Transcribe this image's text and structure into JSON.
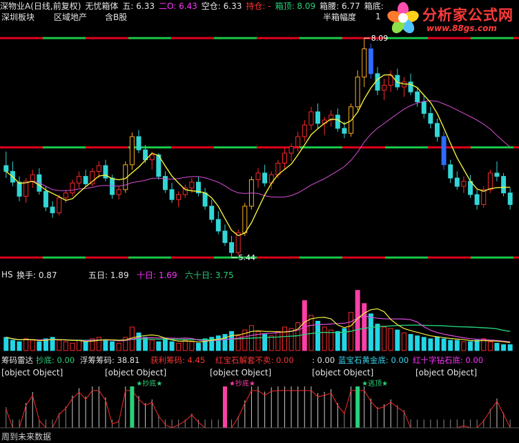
{
  "header": {
    "stock_title": "深物业A(日线,前复权)",
    "indicator_name": "无忧箱体",
    "items": [
      {
        "label": "五: 6.33",
        "color": "#e6e6e6"
      },
      {
        "label": "二O: 6.43",
        "color": "#ff33ff"
      },
      {
        "label": "空仓: 6.33",
        "color": "#e6e6e6"
      },
      {
        "label": "持仓: -",
        "color": "#ff3333"
      },
      {
        "label": "箱顶: 8.09",
        "color": "#27d27a"
      },
      {
        "label": "箱腰: 6.77",
        "color": "#e6e6e6"
      },
      {
        "label": "箱底:",
        "color": "#e6e6e6"
      }
    ],
    "row2": [
      "深圳板块",
      "区域地产",
      "含B股",
      "半箱幅度",
      "1"
    ]
  },
  "logo": {
    "brand": "分析家公式网",
    "site": "www.88gs.com"
  },
  "volume_header": {
    "prefix": "HS",
    "items": [
      {
        "label": "换手: 0.87",
        "color": "#e6e6e6"
      },
      {
        "label": "五日: 1.89",
        "color": "#e6e6e6"
      },
      {
        "label": "十日: 1.69",
        "color": "#ff33ff"
      },
      {
        "label": "六十日: 3.75",
        "color": "#27d27a"
      }
    ]
  },
  "lower_header": {
    "row1": [
      {
        "label": "筹码雷达",
        "color": "#e6e6e6"
      },
      {
        "label": "抄底: 0.00",
        "color": "#27d27a"
      },
      {
        "label": "浮筹筹码: 38.81",
        "color": "#e6e6e6"
      },
      {
        "label": "获利筹码: 4.45",
        "color": "#ff3333"
      },
      {
        "label": "红宝石解套不卖: 0.00",
        "color": "#ff3333"
      },
      {
        "label": ": 0.00",
        "color": "#e6e6e6"
      },
      {
        "label": "蓝宝石黄金底: 0.00",
        "color": "#38d8f0"
      },
      {
        "label": "红十字钻石底: 0.00",
        "color": "#ff33ff"
      }
    ],
    "row2": [
      {
        "label": "黑马起爆吃橘子",
        "color": "#e6e6e6"
      },
      {
        "label": "白色凸起能量大",
        "color": "#e6e6e6"
      },
      {
        "label": "空红柱穿透10",
        "color": "#e6e6e6"
      },
      {
        "label": "红实柱穿透20",
        "color": "#e6e6e6"
      },
      {
        "label": "获利99就走人",
        "color": "#e6e6e6"
      }
    ],
    "markers": [
      "抄底",
      "抄底",
      "逃顶"
    ]
  },
  "footer": {
    "label": "周到未来数据"
  },
  "chart_data": {
    "type": "candlestick",
    "box_levels": {
      "top": 8.09,
      "waist": 6.77,
      "bottom": 5.44
    },
    "annotations": [
      {
        "label": "8.09",
        "value": 8.09
      },
      {
        "label": "5.44",
        "value": 5.44
      }
    ],
    "price_range": [
      5.4,
      8.2
    ],
    "ohlc": [
      [
        6.55,
        6.72,
        6.4,
        6.48
      ],
      [
        6.48,
        6.6,
        6.3,
        6.35
      ],
      [
        6.35,
        6.42,
        6.12,
        6.18
      ],
      [
        6.18,
        6.4,
        6.1,
        6.36
      ],
      [
        6.36,
        6.5,
        6.28,
        6.44
      ],
      [
        6.44,
        6.52,
        6.2,
        6.24
      ],
      [
        6.24,
        6.3,
        6.0,
        6.05
      ],
      [
        6.05,
        6.12,
        5.92,
        5.98
      ],
      [
        5.98,
        6.2,
        5.95,
        6.16
      ],
      [
        6.16,
        6.26,
        6.1,
        6.22
      ],
      [
        6.22,
        6.38,
        6.18,
        6.34
      ],
      [
        6.34,
        6.48,
        6.28,
        6.42
      ],
      [
        6.42,
        6.5,
        6.3,
        6.33
      ],
      [
        6.33,
        6.52,
        6.3,
        6.48
      ],
      [
        6.48,
        6.6,
        6.4,
        6.55
      ],
      [
        6.55,
        6.62,
        6.36,
        6.4
      ],
      [
        6.4,
        6.44,
        6.15,
        6.2
      ],
      [
        6.2,
        6.3,
        6.14,
        6.26
      ],
      [
        6.26,
        6.6,
        6.22,
        6.56
      ],
      [
        6.56,
        6.95,
        6.5,
        6.9
      ],
      [
        6.9,
        6.98,
        6.7,
        6.74
      ],
      [
        6.74,
        6.8,
        6.58,
        6.62
      ],
      [
        6.62,
        6.72,
        6.5,
        6.68
      ],
      [
        6.68,
        6.7,
        6.38,
        6.42
      ],
      [
        6.42,
        6.48,
        6.22,
        6.26
      ],
      [
        6.26,
        6.34,
        6.1,
        6.14
      ],
      [
        6.14,
        6.24,
        6.05,
        6.2
      ],
      [
        6.2,
        6.32,
        6.16,
        6.28
      ],
      [
        6.28,
        6.4,
        6.22,
        6.35
      ],
      [
        6.35,
        6.42,
        6.18,
        6.22
      ],
      [
        6.22,
        6.28,
        6.02,
        6.06
      ],
      [
        6.06,
        6.14,
        5.86,
        5.9
      ],
      [
        5.9,
        6.0,
        5.72,
        5.76
      ],
      [
        5.76,
        5.84,
        5.58,
        5.62
      ],
      [
        5.62,
        5.7,
        5.44,
        5.5
      ],
      [
        5.5,
        5.78,
        5.46,
        5.74
      ],
      [
        5.74,
        6.1,
        5.7,
        6.06
      ],
      [
        6.06,
        6.42,
        6.02,
        6.38
      ],
      [
        6.38,
        6.52,
        6.28,
        6.46
      ],
      [
        6.46,
        6.56,
        6.3,
        6.34
      ],
      [
        6.34,
        6.48,
        6.26,
        6.44
      ],
      [
        6.44,
        6.62,
        6.4,
        6.58
      ],
      [
        6.58,
        6.76,
        6.5,
        6.7
      ],
      [
        6.7,
        6.82,
        6.6,
        6.78
      ],
      [
        6.78,
        6.96,
        6.72,
        6.9
      ],
      [
        6.9,
        7.1,
        6.84,
        7.04
      ],
      [
        7.04,
        7.26,
        6.98,
        7.2
      ],
      [
        7.2,
        7.3,
        7.0,
        7.06
      ],
      [
        7.06,
        7.14,
        6.92,
        7.1
      ],
      [
        7.1,
        7.22,
        7.02,
        7.16
      ],
      [
        7.16,
        7.24,
        6.96,
        7.0
      ],
      [
        7.0,
        7.08,
        6.88,
        6.94
      ],
      [
        6.94,
        7.3,
        6.9,
        7.26
      ],
      [
        7.26,
        7.7,
        7.22,
        7.62
      ],
      [
        7.62,
        8.09,
        7.5,
        7.96
      ],
      [
        7.96,
        8.02,
        7.6,
        7.66
      ],
      [
        7.66,
        7.74,
        7.4,
        7.46
      ],
      [
        7.46,
        7.6,
        7.34,
        7.52
      ],
      [
        7.52,
        7.7,
        7.44,
        7.64
      ],
      [
        7.64,
        7.72,
        7.46,
        7.5
      ],
      [
        7.5,
        7.62,
        7.38,
        7.56
      ],
      [
        7.56,
        7.66,
        7.4,
        7.44
      ],
      [
        7.44,
        7.5,
        7.26,
        7.32
      ],
      [
        7.32,
        7.4,
        7.12,
        7.18
      ],
      [
        7.18,
        7.26,
        7.0,
        7.06
      ],
      [
        7.06,
        7.12,
        6.84,
        6.9
      ],
      [
        6.9,
        6.96,
        6.5,
        6.56
      ],
      [
        6.56,
        6.62,
        6.34,
        6.4
      ],
      [
        6.4,
        6.48,
        6.26,
        6.3
      ],
      [
        6.3,
        6.42,
        6.22,
        6.36
      ],
      [
        6.36,
        6.44,
        6.16,
        6.2
      ],
      [
        6.2,
        6.26,
        6.02,
        6.08
      ],
      [
        6.08,
        6.3,
        6.04,
        6.26
      ],
      [
        6.26,
        6.5,
        6.22,
        6.46
      ],
      [
        6.46,
        6.6,
        6.36,
        6.42
      ],
      [
        6.42,
        6.46,
        6.18,
        6.22
      ],
      [
        6.22,
        6.28,
        6.02,
        6.08
      ]
    ],
    "volume_values": [
      0.9,
      0.7,
      0.6,
      0.8,
      0.7,
      0.6,
      0.8,
      0.9,
      0.7,
      0.6,
      0.5,
      0.7,
      0.6,
      0.8,
      0.9,
      0.7,
      0.6,
      0.5,
      0.9,
      1.6,
      1.2,
      0.9,
      0.7,
      0.6,
      0.8,
      0.6,
      0.5,
      0.7,
      0.6,
      0.5,
      0.8,
      0.9,
      1.0,
      1.1,
      1.3,
      1.0,
      1.4,
      1.7,
      1.3,
      1.1,
      1.0,
      1.3,
      1.6,
      1.5,
      1.9,
      3.4,
      2.4,
      2.0,
      1.6,
      1.4,
      1.3,
      1.5,
      2.6,
      4.1,
      3.2,
      2.5,
      1.8,
      1.6,
      1.5,
      1.4,
      1.2,
      1.1,
      1.0,
      0.9,
      0.8,
      0.9,
      0.8,
      0.7,
      0.7,
      0.6,
      0.6,
      0.7,
      0.8,
      0.6,
      0.5,
      0.4,
      0.4
    ]
  }
}
